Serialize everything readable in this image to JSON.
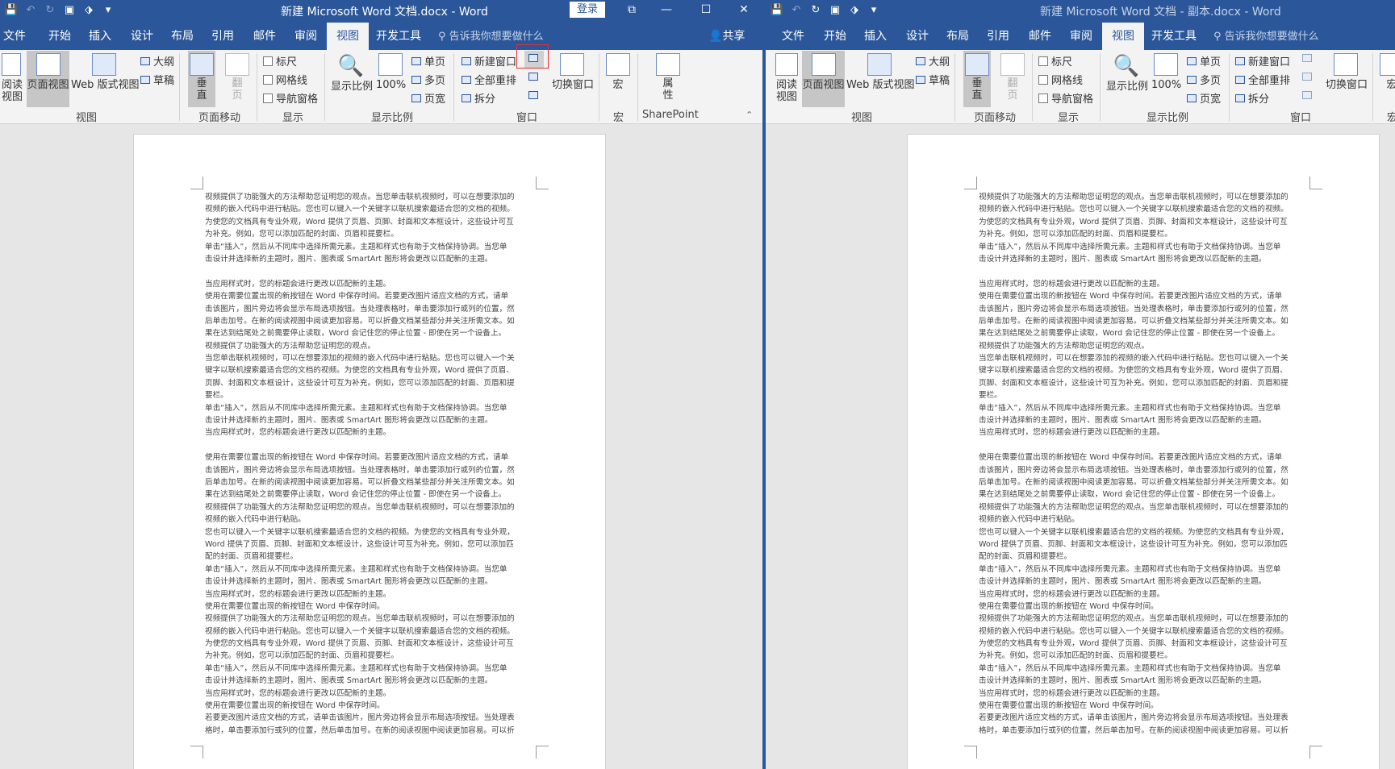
{
  "windows": [
    {
      "title": "新建 Microsoft Word 文档.docx  -  Word",
      "login_label": "登录",
      "share_label": "共享",
      "tell_me_placeholder": "告诉我你想要做什么",
      "tabs": [
        "文件",
        "开始",
        "插入",
        "设计",
        "布局",
        "引用",
        "邮件",
        "审阅",
        "视图",
        "开发工具"
      ],
      "active_tab": "视图"
    },
    {
      "title": "新建 Microsoft Word 文档 - 副本.docx  -  Word",
      "tell_me_placeholder": "告诉我你想要做什么",
      "tabs": [
        "文件",
        "开始",
        "插入",
        "设计",
        "布局",
        "引用",
        "邮件",
        "审阅",
        "视图",
        "开发工具"
      ],
      "active_tab": "视图"
    }
  ],
  "ribbon": {
    "views": {
      "read": "阅读\n视图",
      "print": "页面视图",
      "web": "Web 版式视图",
      "outline": "大纲",
      "draft": "草稿",
      "group": "视图"
    },
    "page_move": {
      "vertical": "垂\n直",
      "side": "翻\n页",
      "group": "页面移动"
    },
    "show": {
      "ruler": "标尺",
      "gridlines": "网格线",
      "nav_pane": "导航窗格",
      "group": "显示"
    },
    "zoom": {
      "zoom": "显示比例",
      "hundred": "100%",
      "one_page": "单页",
      "multi_page": "多页",
      "page_width": "页宽",
      "group": "显示比例"
    },
    "window": {
      "new_window": "新建窗口",
      "arrange_all": "全部重排",
      "split": "拆分",
      "switch": "切换窗口",
      "group": "窗口"
    },
    "macros": {
      "label": "宏",
      "group": "宏"
    },
    "sharepoint": {
      "label": "属\n性",
      "group": "SharePoint"
    }
  },
  "icons": {
    "save": "save-icon",
    "undo": "undo-icon",
    "redo": "redo-icon",
    "repeat": "repeat-icon",
    "customize": "customize-qat-icon",
    "restore": "restore-window-icon",
    "minimize": "minimize-icon",
    "maximize": "maximize-icon",
    "close": "close-icon",
    "lightbulb": "lightbulb-icon",
    "person": "person-icon",
    "collapse": "collapse-ribbon-icon"
  },
  "document": {
    "lines": [
      "视频提供了功能强大的方法帮助您证明您的观点。当您单击联机视频时，可以在想要添加的",
      "视频的嵌入代码中进行粘贴。您也可以键入一个关键字以联机搜索最适合您的文档的视频。",
      "为使您的文档具有专业外观，Word 提供了页眉、页脚、封面和文本框设计，这些设计可互",
      "为补充。例如，您可以添加匹配的封面、页眉和提要栏。",
      "单击“插入”，然后从不同库中选择所需元素。主题和样式也有助于文档保持协调。当您单",
      "击设计并选择新的主题时，图片、图表或 SmartArt 图形将会更改以匹配新的主题。",
      "",
      "当应用样式时，您的标题会进行更改以匹配新的主题。",
      "使用在需要位置出现的新按钮在 Word 中保存时间。若要更改图片适应文档的方式，请单",
      "击该图片，图片旁边将会显示布局选项按钮。当处理表格时，单击要添加行或列的位置，然",
      "后单击加号。在新的阅读视图中阅读更加容易。可以折叠文档某些部分并关注所需文本。如",
      "果在达到结尾处之前需要停止读取，Word 会记住您的停止位置 - 即使在另一个设备上。",
      "视频提供了功能强大的方法帮助您证明您的观点。",
      "当您单击联机视频时，可以在想要添加的视频的嵌入代码中进行粘贴。您也可以键入一个关",
      "键字以联机搜索最适合您的文档的视频。为使您的文档具有专业外观，Word 提供了页眉、",
      "页脚、封面和文本框设计，这些设计可互为补充。例如，您可以添加匹配的封面、页眉和提",
      "要栏。",
      "单击“插入”，然后从不同库中选择所需元素。主题和样式也有助于文档保持协调。当您单",
      "击设计并选择新的主题时，图片、图表或 SmartArt 图形将会更改以匹配新的主题。",
      "当应用样式时，您的标题会进行更改以匹配新的主题。",
      "",
      "使用在需要位置出现的新按钮在 Word 中保存时间。若要更改图片适应文档的方式，请单",
      "击该图片，图片旁边将会显示布局选项按钮。当处理表格时，单击要添加行或列的位置，然",
      "后单击加号。在新的阅读视图中阅读更加容易。可以折叠文档某些部分并关注所需文本。如",
      "果在达到结尾处之前需要停止读取，Word 会记住您的停止位置 - 即使在另一个设备上。",
      "视频提供了功能强大的方法帮助您证明您的观点。当您单击联机视频时，可以在想要添加的",
      "视频的嵌入代码中进行粘贴。",
      "您也可以键入一个关键字以联机搜索最适合您的文档的视频。为使您的文档具有专业外观，",
      "Word 提供了页眉、页脚、封面和文本框设计，这些设计可互为补充。例如，您可以添加匹",
      "配的封面、页眉和提要栏。",
      "单击“插入”，然后从不同库中选择所需元素。主题和样式也有助于文档保持协调。当您单",
      "击设计并选择新的主题时，图片、图表或 SmartArt 图形将会更改以匹配新的主题。",
      "当应用样式时，您的标题会进行更改以匹配新的主题。",
      "使用在需要位置出现的新按钮在 Word 中保存时间。",
      "视频提供了功能强大的方法帮助您证明您的观点。当您单击联机视频时，可以在想要添加的",
      "视频的嵌入代码中进行粘贴。您也可以键入一个关键字以联机搜索最适合您的文档的视频。",
      "为使您的文档具有专业外观，Word 提供了页眉、页脚、封面和文本框设计，这些设计可互",
      "为补充。例如，您可以添加匹配的封面、页眉和提要栏。",
      "单击“插入”，然后从不同库中选择所需元素。主题和样式也有助于文档保持协调。当您单",
      "击设计并选择新的主题时，图片、图表或 SmartArt 图形将会更改以匹配新的主题。",
      "当应用样式时，您的标题会进行更改以匹配新的主题。",
      "使用在需要位置出现的新按钮在 Word 中保存时间。",
      "若要更改图片适应文档的方式，请单击该图片，图片旁边将会显示布局选项按钮。当处理表",
      "格时，单击要添加行或列的位置，然后单击加号。在新的阅读视图中阅读更加容易。可以折"
    ]
  }
}
